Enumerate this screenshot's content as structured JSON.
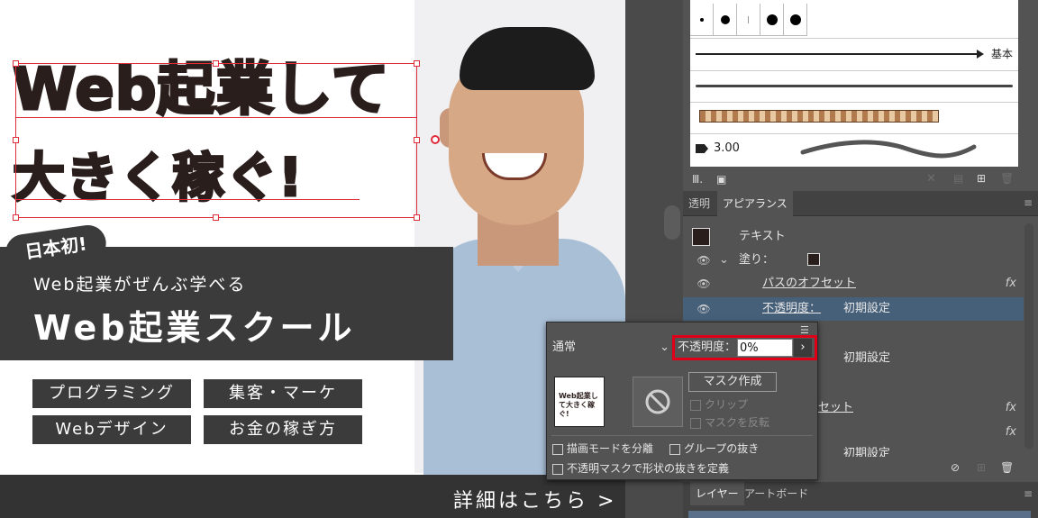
{
  "banner": {
    "headline_line1": "Web起業して",
    "headline_line2": "大きく稼ぐ!",
    "badge": "日本初!",
    "subtitle": "Web起業がぜんぶ学べる",
    "school_name": "Web起業スクール",
    "tags": [
      "プログラミング",
      "集客・マーケ",
      "Webデザイン",
      "お金の稼ぎ方"
    ],
    "more_link": "詳細はこちら >"
  },
  "brushes": {
    "basic_label": "基本",
    "stroke_weight": "3.00"
  },
  "panel": {
    "tabs": [
      "透明",
      "アピアランス"
    ],
    "active_tab": "アピアランス"
  },
  "appearance": {
    "rows": [
      {
        "label": "テキスト"
      },
      {
        "label": "塗り：",
        "expanded": true
      },
      {
        "label": "パスのオフセット",
        "fx": "fx"
      },
      {
        "label": "不透明度：",
        "value": "初期設定"
      },
      {
        "label": "初期設定"
      },
      {
        "label": "セット",
        "fx": "fx"
      },
      {
        "fx": "fx"
      },
      {
        "label": "初期設定"
      }
    ]
  },
  "transparency_popup": {
    "blend_mode": "通常",
    "opacity_label": "不透明度：",
    "opacity_value": "0%",
    "make_mask_button": "マスク作成",
    "clip_label": "クリップ",
    "invert_mask_label": "マスクを反転",
    "isolate_blending_label": "描画モードを分離",
    "knockout_group_label": "グループの抜き",
    "opacity_mask_knockout_label": "不透明マスクで形状の抜きを定義",
    "thumb_text": "Web起業して大きく稼ぐ!"
  },
  "layers": {
    "tabs": [
      "レイヤー",
      "アートボード"
    ]
  }
}
